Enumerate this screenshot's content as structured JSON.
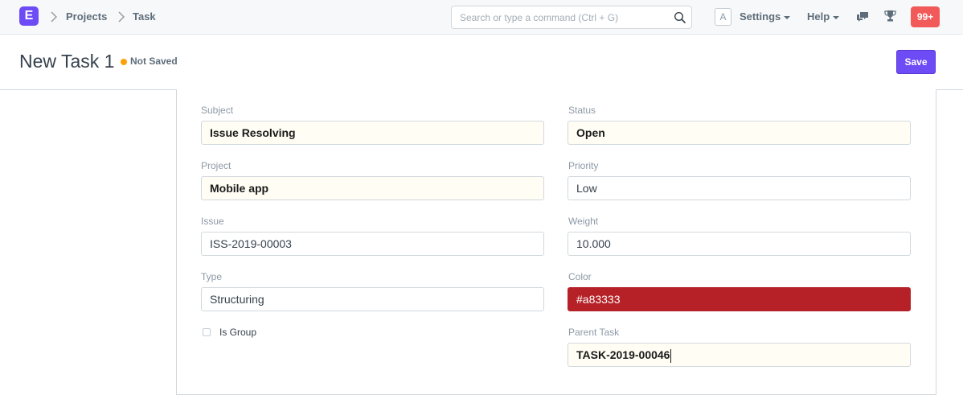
{
  "app": {
    "logo_letter": "E"
  },
  "breadcrumbs": [
    "Projects",
    "Task"
  ],
  "search": {
    "placeholder": "Search or type a command (Ctrl + G)"
  },
  "navbar": {
    "avatar_letter": "A",
    "settings_label": "Settings",
    "help_label": "Help",
    "notification_count": "99+"
  },
  "page": {
    "title": "New Task 1",
    "status_indicator": "Not Saved",
    "save_label": "Save"
  },
  "form": {
    "subject": {
      "label": "Subject",
      "value": "Issue Resolving"
    },
    "project": {
      "label": "Project",
      "value": "Mobile app"
    },
    "issue": {
      "label": "Issue",
      "value": "ISS-2019-00003"
    },
    "type": {
      "label": "Type",
      "value": "Structuring"
    },
    "is_group": {
      "label": "Is Group",
      "checked": false
    },
    "status": {
      "label": "Status",
      "value": "Open"
    },
    "priority": {
      "label": "Priority",
      "value": "Low"
    },
    "weight": {
      "label": "Weight",
      "value": "10.000"
    },
    "color": {
      "label": "Color",
      "value": "#a83333"
    },
    "parent_task": {
      "label": "Parent Task",
      "value": "TASK-2019-00046"
    }
  },
  "colors": {
    "brand": "#6e4cf5",
    "not_saved_dot": "#ffa00a",
    "notification": "#f25a5a",
    "color_field": "#b52127"
  },
  "icons": [
    "search-icon",
    "chat-icon",
    "trophy-icon",
    "chevron-right-icon"
  ]
}
